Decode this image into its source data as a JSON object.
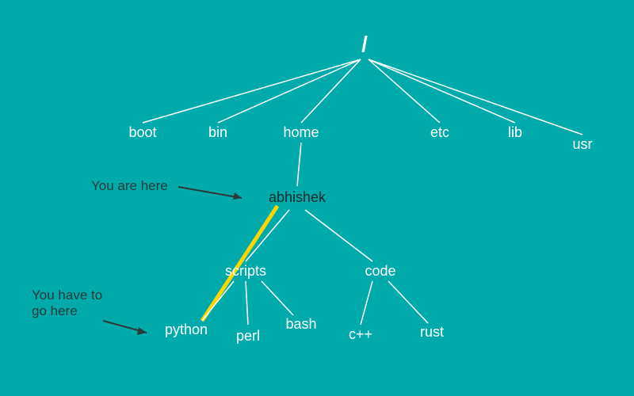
{
  "root": "/",
  "level1": {
    "boot": "boot",
    "bin": "bin",
    "home": "home",
    "etc": "etc",
    "lib": "lib",
    "usr": "usr"
  },
  "level2": {
    "abhishek": "abhishek"
  },
  "level3": {
    "scripts": "scripts",
    "code": "code"
  },
  "level4": {
    "python": "python",
    "perl": "perl",
    "bash": "bash",
    "cpp": "c++",
    "rust": "rust"
  },
  "annotations": {
    "you_are_here": "You are here",
    "you_have_to_go_here_l1": "You have to",
    "you_have_to_go_here_l2": "go here"
  }
}
